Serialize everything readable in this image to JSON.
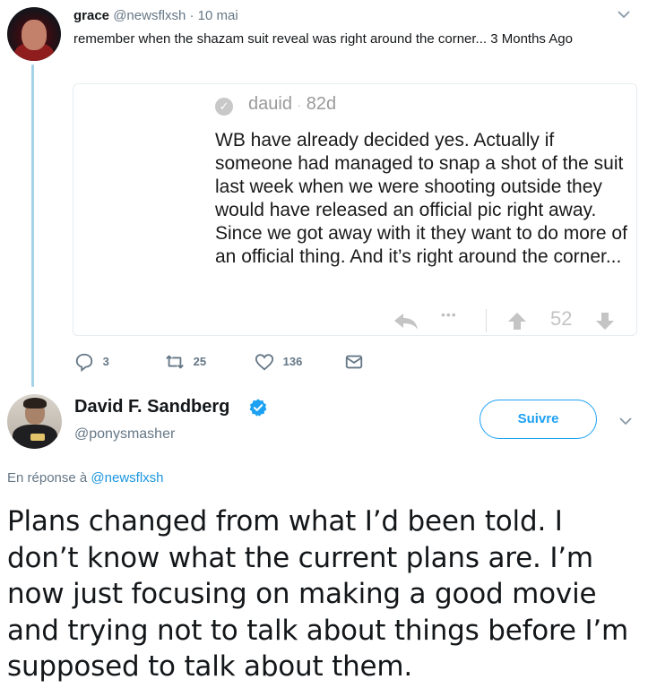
{
  "tweet1": {
    "name": "grace",
    "handle": "@newsflxsh",
    "separator": "·",
    "date": "10 mai",
    "text": "remember when the shazam suit reveal was right around the corner... 3 Months Ago"
  },
  "quote": {
    "user": "dauid",
    "separator": "·",
    "age": "82d",
    "text": "WB have already decided yes. Actually if someone had managed to snap a shot of the suit last week when we were shooting outside they would have released an official pic right away. Since we got away with it they want to do more of an official thing. And it’s right around the corner...",
    "dots": "•••",
    "score": "52"
  },
  "actions": {
    "replies": "3",
    "retweets": "25",
    "likes": "136"
  },
  "tweet2": {
    "name": "David F. Sandberg",
    "handle": "@ponysmasher",
    "follow_label": "Suivre",
    "reply_prefix": "En réponse à",
    "reply_to": "@newsflxsh",
    "text": "Plans changed from what I’d been told. I don’t know what the current plans are. I’m now just focusing on making a good movie and trying not to talk about things before I’m supposed to talk about them."
  },
  "colors": {
    "accent": "#1da1f2",
    "thread_line": "#a3d3e9",
    "muted": "#657786"
  },
  "icons": [
    "reply-icon",
    "retweet-icon",
    "like-icon",
    "message-icon",
    "verified-icon",
    "chevron-down-icon",
    "share-icon",
    "upvote-icon",
    "downvote-icon",
    "check-icon"
  ]
}
